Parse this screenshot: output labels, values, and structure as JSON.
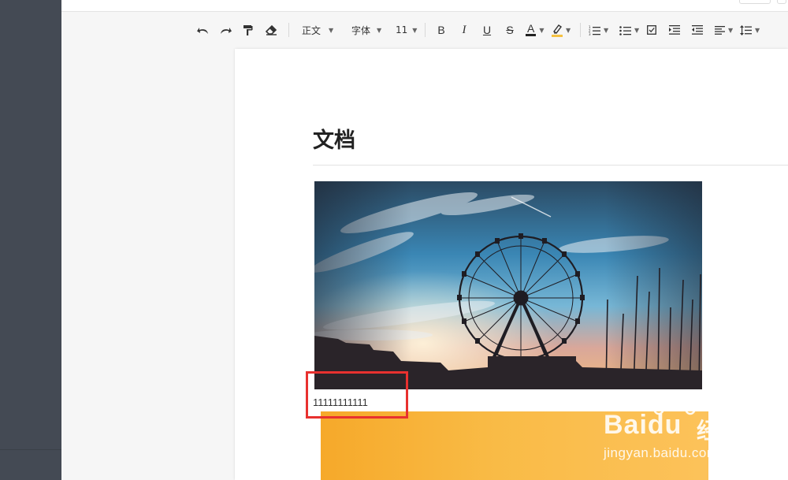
{
  "toolbar": {
    "undo_icon": "undo-icon",
    "redo_icon": "redo-icon",
    "format_painter_icon": "format-painter-icon",
    "clear_format_icon": "eraser-icon",
    "paragraph_style": "正文",
    "font_family": "字体",
    "font_size": "11",
    "bold_label": "B",
    "italic_label": "I",
    "underline_label": "U",
    "strikethrough_label": "S",
    "font_color_label": "A",
    "font_color": "#222222",
    "highlight_color": "#f5c242"
  },
  "document": {
    "title": "文档",
    "body_text": "11111111111"
  },
  "watermark": {
    "brand": "Baidu",
    "brand_cn": "经验",
    "url": "jingyan.baidu.com"
  },
  "colors": {
    "sidebar": "#444a54",
    "highlight_box": "#e8312f",
    "page": "#ffffff",
    "canvas": "#f6f6f6"
  }
}
